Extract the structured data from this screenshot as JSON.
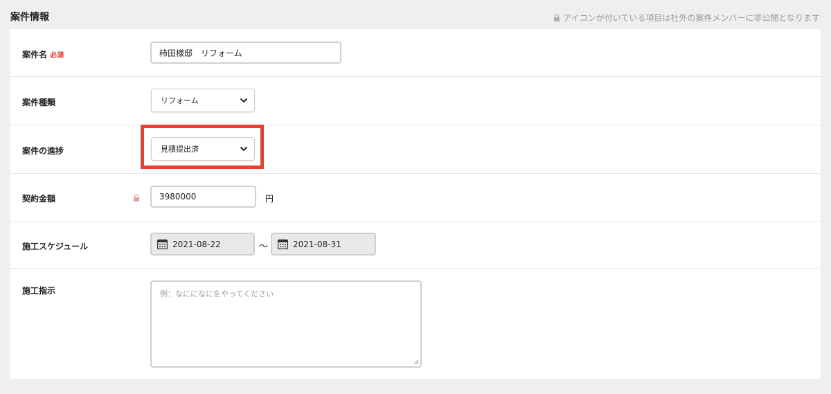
{
  "section": {
    "title": "案件情報",
    "notice": "アイコンが付いている項目は社外の案件メンバーに非公開となります"
  },
  "fields": {
    "name": {
      "label": "案件名",
      "required": "必須",
      "value": "柿田様邸　リフォーム"
    },
    "type": {
      "label": "案件種類",
      "value": "リフォーム"
    },
    "progress": {
      "label": "案件の進捗",
      "value": "見積提出済"
    },
    "amount": {
      "label": "契約金額",
      "value": "3980000",
      "unit": "円"
    },
    "schedule": {
      "label": "施工スケジュール",
      "start": "2021-08-22",
      "separator": "〜",
      "end": "2021-08-31"
    },
    "instructions": {
      "label": "施工指示",
      "placeholder": "例：なにになにをやってください"
    }
  },
  "colors": {
    "highlight": "#e8412c",
    "required": "#d9392b",
    "lock": "#e0a3a3"
  },
  "icons": [
    "lock-icon",
    "chevron-down-icon",
    "calendar-icon",
    "resize-grip-icon"
  ]
}
